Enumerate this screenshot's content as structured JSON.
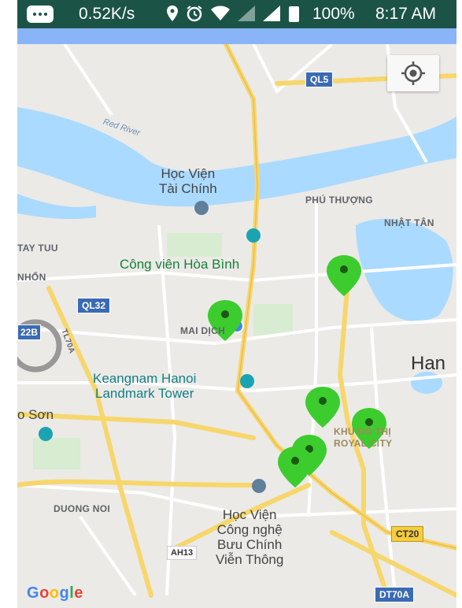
{
  "status_bar": {
    "speed": "0.52K/s",
    "battery": "100%",
    "time": "8:17 AM",
    "icons": [
      "message-icon",
      "location-pin-icon",
      "alarm-icon",
      "wifi-icon",
      "signal-icon",
      "signal-r-icon",
      "battery-icon"
    ]
  },
  "map": {
    "labels": {
      "red_river": "Red River",
      "hv_tai_chinh": "Học Viện\nTài Chính",
      "phu_thuong": "PHÚ THƯỢNG",
      "nhat_tan": "NHẬT TÂN",
      "tay_tuu": "TAY TUU",
      "nhon": "NHỔN",
      "cong_vien": "Công viên Hòa Bình",
      "mai_dich": "MAI DỊCH",
      "hanoi": "Han",
      "keangnam": "Keangnam Hanoi\nLandmark Tower",
      "son": "o Sơn",
      "royal_city": "KHU ĐÔ THỊ\nROYAL CITY",
      "duong_noi": "DUONG NOI",
      "hv_buu_chinh": "Học Viện\nCông nghệ\nBưu Chính\nViễn Thông",
      "google": "Google"
    },
    "shields": {
      "ql5": "QL5",
      "ql32": "QL32",
      "r22b": "22B",
      "tl70a": "TL70A",
      "ct20": "CT20",
      "ah13": "AH13",
      "dt70a": "DT70A"
    },
    "colors": {
      "marker": "#3ccc2e",
      "water": "#aadaff",
      "highway": "#f5cd3d",
      "my_location": "#4285f4"
    },
    "markers_count_visible": 6
  }
}
